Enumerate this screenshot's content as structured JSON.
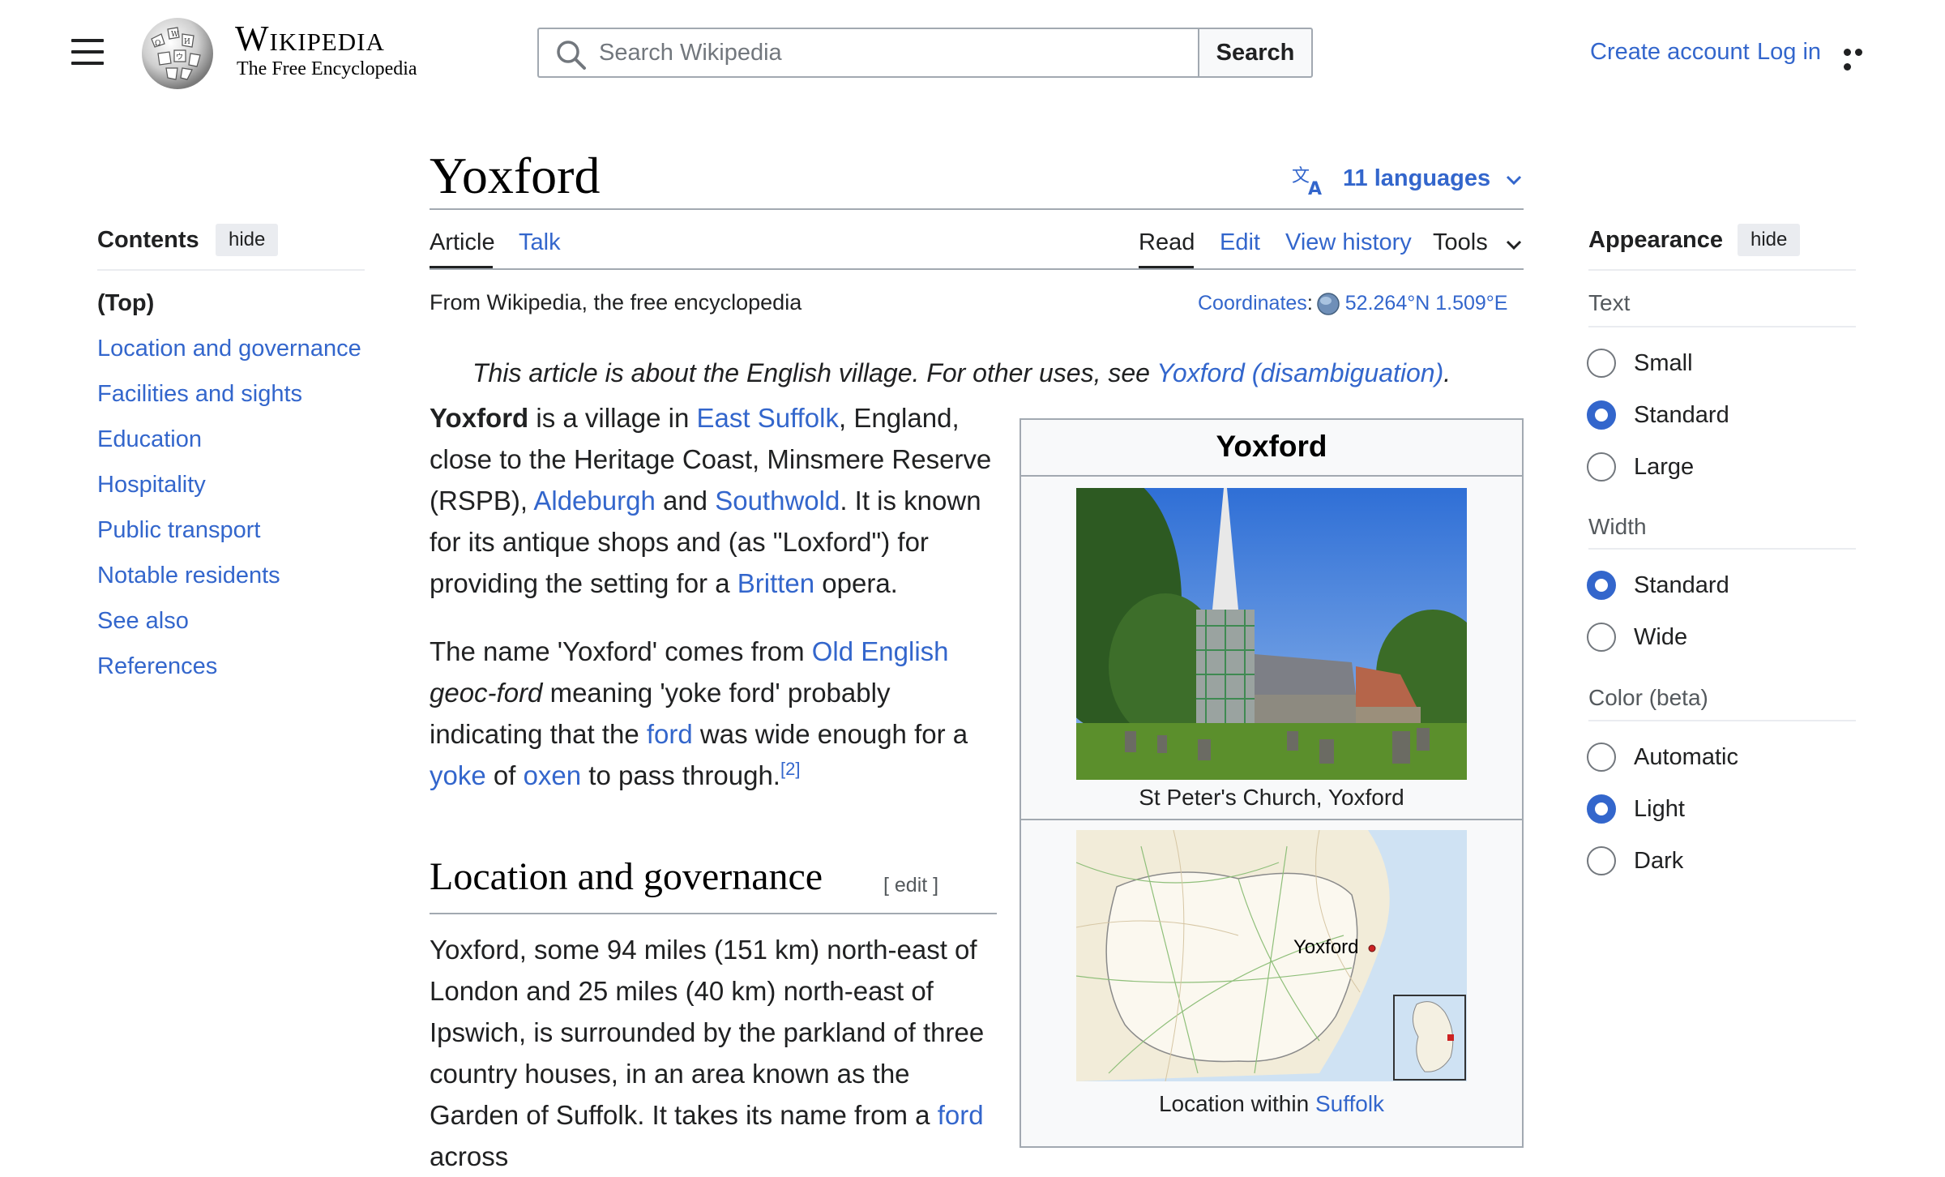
{
  "header": {
    "wordmark": "Wikipedia",
    "tagline": "The Free Encyclopedia",
    "search_placeholder": "Search Wikipedia",
    "search_button": "Search",
    "create_account": "Create account",
    "log_in": "Log in"
  },
  "toc": {
    "title": "Contents",
    "hide": "hide",
    "top": "(Top)",
    "items": [
      "Location and governance",
      "Facilities and sights",
      "Education",
      "Hospitality",
      "Public transport",
      "Notable residents",
      "See also",
      "References"
    ]
  },
  "article": {
    "title": "Yoxford",
    "languages": "11 languages",
    "tabs": {
      "article": "Article",
      "talk": "Talk",
      "read": "Read",
      "edit": "Edit",
      "history": "View history",
      "tools": "Tools"
    },
    "from": "From Wikipedia, the free encyclopedia",
    "coords_label": "Coordinates",
    "coords_value": "52.264°N 1.509°E",
    "hatnote_pre": "This article is about the English village. For other uses, see ",
    "hatnote_link": "Yoxford (disambiguation)",
    "hatnote_post": ".",
    "p1": {
      "bold": "Yoxford",
      "t1": " is a village in ",
      "l1": "East Suffolk",
      "t2": ", England, close to the Heritage Coast, Minsmere Reserve (RSPB), ",
      "l2": "Aldeburgh",
      "t3": " and ",
      "l3": "Southwold",
      "t4": ". It is known for its antique shops and (as \"Loxford\") for providing the setting for a ",
      "l4": "Britten",
      "t5": " opera."
    },
    "p2": {
      "t1": "The name 'Yoxford' comes from ",
      "l1": "Old English",
      "t2": " ",
      "i1": "geoc-ford",
      "t3": " meaning 'yoke ford' probably indicating that the ",
      "l2": "ford",
      "t4": " was wide enough for a ",
      "l3": "yoke",
      "t5": " of ",
      "l4": "oxen",
      "t6": " to pass through.",
      "ref": "[2]"
    },
    "section_heading": "Location and governance",
    "section_edit": "[ edit ]",
    "p3": {
      "t1": "Yoxford, some 94 miles (151 km) north-east of London and 25 miles (40 km) north-east of Ipswich, is surrounded by the parkland of three country houses, in an area known as the Garden of Suffolk. It takes its name from a ",
      "l1": "ford",
      "t2": " across"
    }
  },
  "infobox": {
    "title": "Yoxford",
    "image_caption": "St Peter's Church, Yoxford",
    "map_label": "Yoxford",
    "map_caption_pre": "Location within ",
    "map_caption_link": "Suffolk"
  },
  "appearance": {
    "title": "Appearance",
    "hide": "hide",
    "text_label": "Text",
    "text_options": [
      "Small",
      "Standard",
      "Large"
    ],
    "text_selected": "Standard",
    "width_label": "Width",
    "width_options": [
      "Standard",
      "Wide"
    ],
    "width_selected": "Standard",
    "color_label": "Color (beta)",
    "color_options": [
      "Automatic",
      "Light",
      "Dark"
    ],
    "color_selected": "Light"
  },
  "colors": {
    "link": "#3366cc",
    "text": "#202122",
    "border": "#a2a9b1"
  }
}
